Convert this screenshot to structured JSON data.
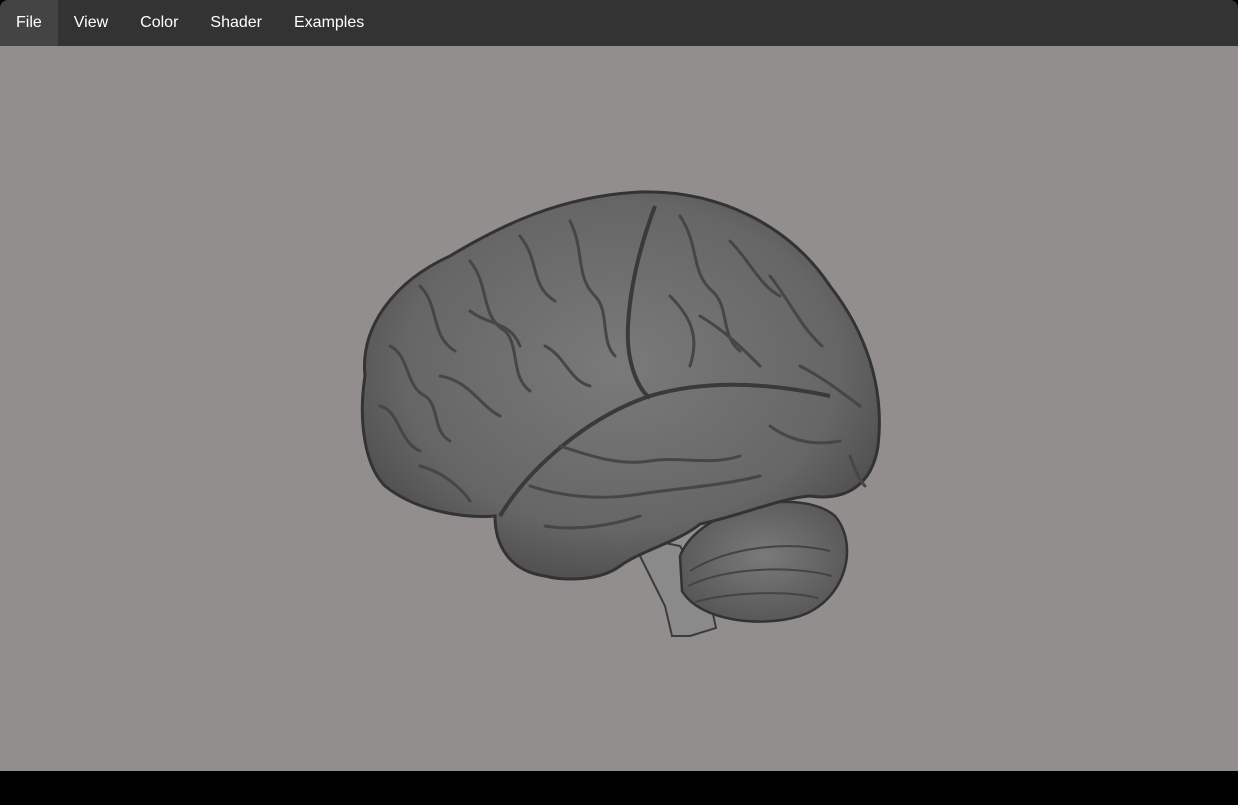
{
  "menu": {
    "items": [
      {
        "label": "File"
      },
      {
        "label": "View"
      },
      {
        "label": "Color"
      },
      {
        "label": "Shader"
      },
      {
        "label": "Examples"
      }
    ]
  },
  "viewport": {
    "background": "#928e8d",
    "model": "brain-mesh",
    "mesh_color": "#6b6b6b"
  },
  "colors": {
    "menubar": "#333333",
    "menu_text": "#ffffff",
    "statusbar": "#000000"
  }
}
